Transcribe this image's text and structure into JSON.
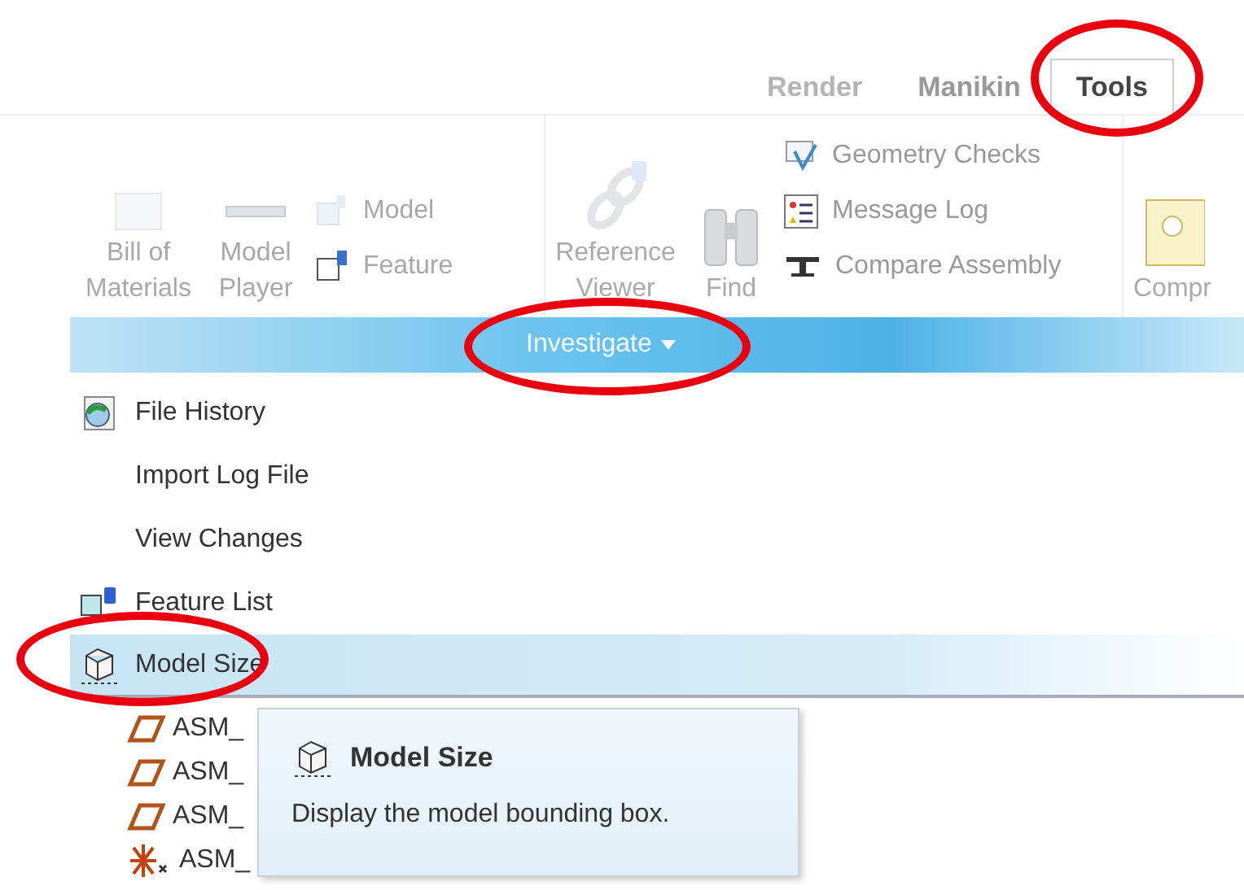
{
  "ribbon": {
    "tabs": [
      {
        "label": "Render",
        "selected": false,
        "circled": false
      },
      {
        "label": "Manikin",
        "selected": false,
        "circled": false
      },
      {
        "label": "Tools",
        "selected": true,
        "circled": true
      }
    ],
    "groups": [
      {
        "large": [
          "Bill of Materials",
          "Model Player"
        ],
        "small": [
          "Model",
          "Feature"
        ]
      },
      {
        "large": [
          "Reference Viewer",
          "Find"
        ],
        "small": [
          "Geometry Checks",
          "Message Log",
          "Compare Assembly"
        ]
      },
      {
        "large": [
          "Compr"
        ]
      }
    ],
    "group_bar": {
      "label": "Investigate",
      "circled": true
    }
  },
  "menu": {
    "items": [
      {
        "label": "File History",
        "selected": false,
        "circled": false
      },
      {
        "label": "Import Log File",
        "selected": false,
        "circled": false
      },
      {
        "label": "View Changes",
        "selected": false,
        "circled": false
      },
      {
        "label": "Feature List",
        "selected": false,
        "circled": false
      },
      {
        "label": "Model Size",
        "selected": true,
        "circled": true
      }
    ]
  },
  "tree": {
    "items": [
      {
        "kind": "plane",
        "label": "ASM_"
      },
      {
        "kind": "plane",
        "label": "ASM_"
      },
      {
        "kind": "plane",
        "label": "ASM_"
      },
      {
        "kind": "csys",
        "label": "ASM_"
      }
    ]
  },
  "tooltip": {
    "title": "Model Size",
    "text": "Display the model bounding box."
  }
}
